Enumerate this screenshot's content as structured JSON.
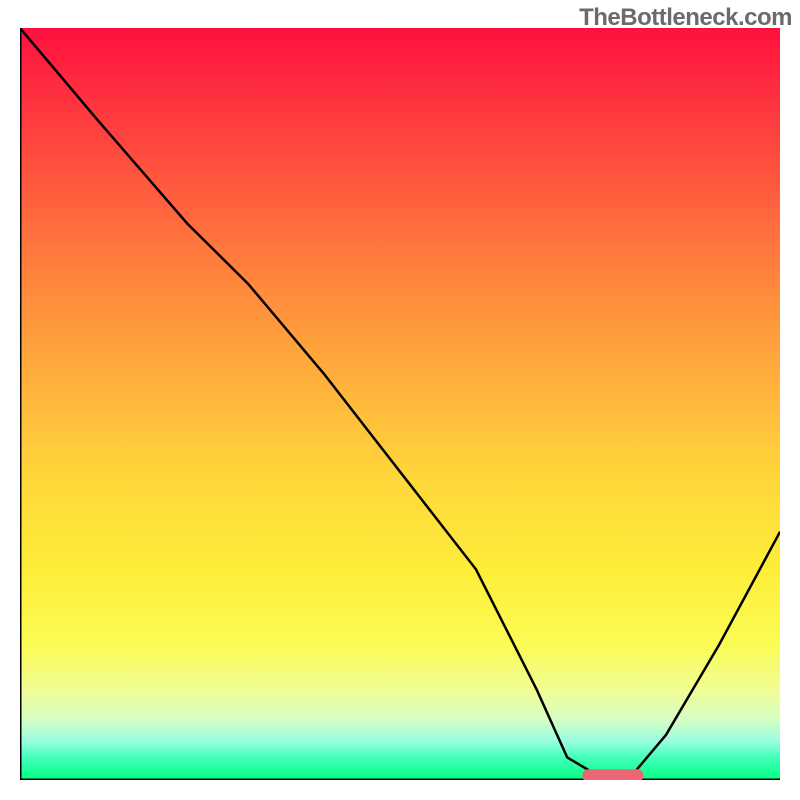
{
  "watermark": "TheBottleneck.com",
  "chart_data": {
    "type": "line",
    "title": "",
    "xlabel": "",
    "ylabel": "",
    "xlim": [
      0,
      100
    ],
    "ylim": [
      0,
      100
    ],
    "grid": false,
    "background": "red-yellow-green-vertical-gradient",
    "series": [
      {
        "name": "bottleneck-curve",
        "x": [
          0,
          10,
          22,
          30,
          40,
          50,
          60,
          68,
          72,
          77,
          80,
          85,
          92,
          100
        ],
        "y": [
          100,
          88,
          74,
          66,
          54,
          41,
          28,
          12,
          3,
          0,
          0,
          6,
          18,
          33
        ]
      }
    ],
    "marker": {
      "name": "optimal-zone",
      "x_start": 74,
      "x_end": 82,
      "y": 0.5,
      "color": "#eb6773"
    }
  }
}
